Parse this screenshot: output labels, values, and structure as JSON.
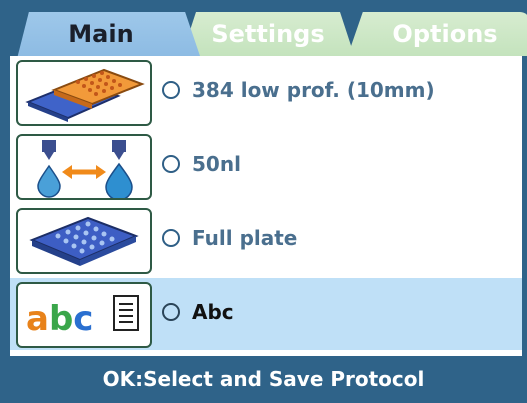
{
  "tabs": [
    {
      "label": "Main"
    },
    {
      "label": "Settings"
    },
    {
      "label": "Options"
    }
  ],
  "rows": [
    {
      "label": "384 low prof. (10mm)",
      "icon": "plate-icon"
    },
    {
      "label": "50nl",
      "icon": "dispense-volume-icon"
    },
    {
      "label": "Full plate",
      "icon": "full-plate-icon"
    },
    {
      "label": "Abc",
      "icon": "abc-name-icon",
      "icon_text": "abc"
    }
  ],
  "footer": {
    "text": "OK:Select and Save Protocol"
  },
  "colors": {
    "accent": "#2f6389",
    "active_tab": "#9ec8ea",
    "inactive_tab": "#c4e3bd",
    "selected_row": "#bfe0f7"
  }
}
